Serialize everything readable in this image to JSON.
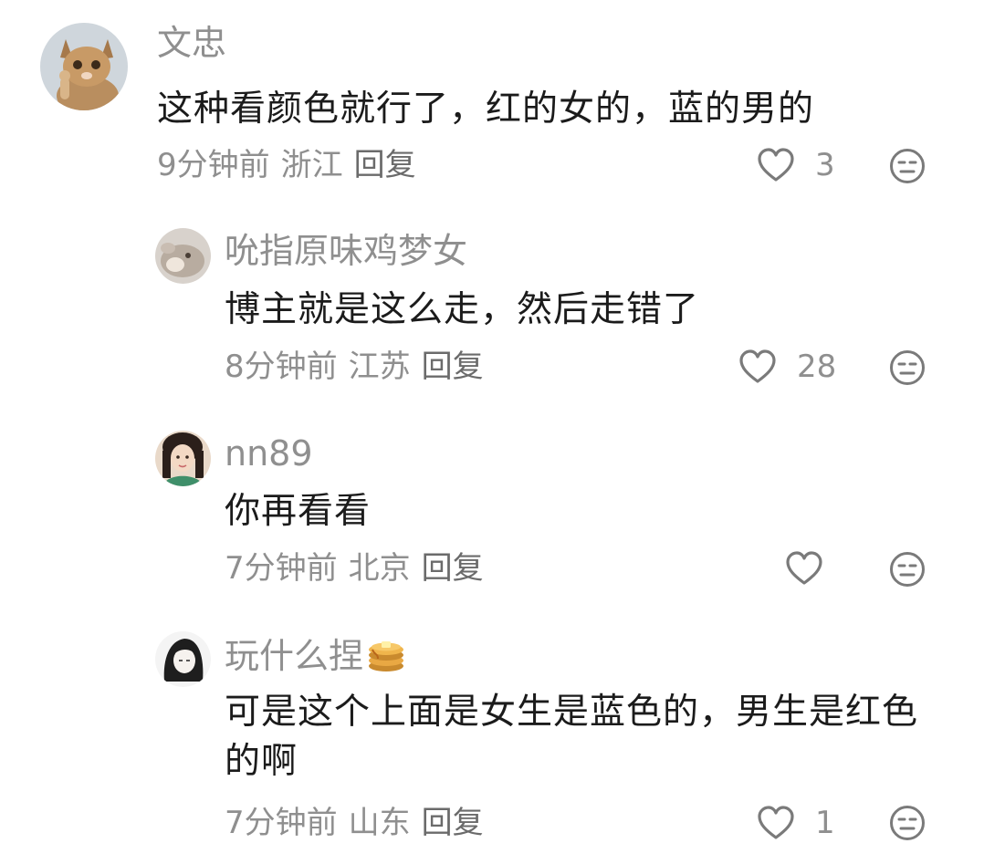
{
  "comments": [
    {
      "username": "文忠",
      "text": "这种看颜色就行了，红的女的，蓝的男的",
      "time": "9分钟前",
      "location": "浙江",
      "reply_label": "回复",
      "likes": "3",
      "avatar": "kitten-thumbs-up"
    },
    {
      "username": "吮指原味鸡梦女",
      "text": "博主就是这么走，然后走错了",
      "time": "8分钟前",
      "location": "江苏",
      "reply_label": "回复",
      "likes": "28",
      "avatar": "cat-photo"
    },
    {
      "username": "nn89",
      "text": "你再看看",
      "time": "7分钟前",
      "location": "北京",
      "reply_label": "回复",
      "likes": "",
      "avatar": "woman-portrait"
    },
    {
      "username": "玩什么捏",
      "username_emoji": "pancake-icon",
      "text": "可是这个上面是女生是蓝色的，男生是红色的啊",
      "time": "7分钟前",
      "location": "山东",
      "reply_label": "回复",
      "likes": "1",
      "avatar": "anime-girl-sketch"
    }
  ],
  "colors": {
    "meta_gray": "#8f8f8f",
    "text_dark": "#1b1b1b",
    "icon_gray": "#7a7a7a"
  }
}
